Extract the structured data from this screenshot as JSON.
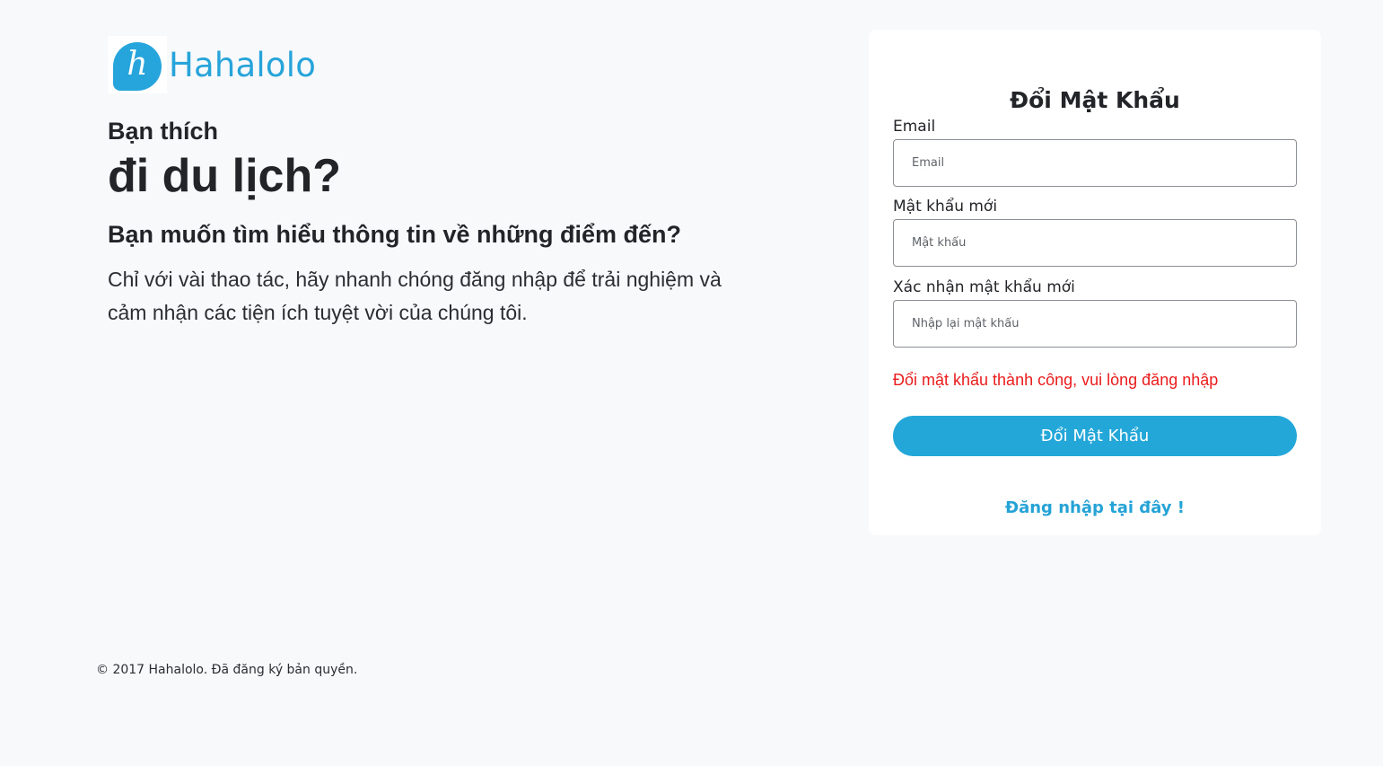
{
  "brand": {
    "logo_letter": "h",
    "name": "Hahalolo",
    "color": "#27a4d9"
  },
  "intro": {
    "line1": "Bạn thích",
    "line2": "đi du lịch?",
    "subtitle": "Bạn muốn tìm hiểu thông tin về những điểm đến?",
    "description": "Chỉ với vài thao tác, hãy nhanh chóng đăng nhập để trải nghiệm và cảm nhận các tiện ích tuyệt vời của chúng tôi."
  },
  "form": {
    "title": "Đổi Mật Khẩu",
    "email": {
      "label": "Email",
      "placeholder": "Email",
      "value": ""
    },
    "new_password": {
      "label": "Mật khẩu mới",
      "placeholder": "Mật khẩu",
      "value": ""
    },
    "confirm_password": {
      "label": "Xác nhận mật khẩu mới",
      "placeholder": "Nhập lại mật khẩu",
      "value": ""
    },
    "message": "Đổi mật khẩu thành công, vui lòng đăng nhập",
    "submit_label": "Đổi Mật Khẩu",
    "login_link": "Đăng nhập tại đây !"
  },
  "footer": {
    "copyright": "© 2017 Hahalolo. Đã đăng ký bản quyền."
  },
  "colors": {
    "accent": "#23a6d8",
    "error": "#ea1c1c",
    "background": "#f8f9fb"
  }
}
